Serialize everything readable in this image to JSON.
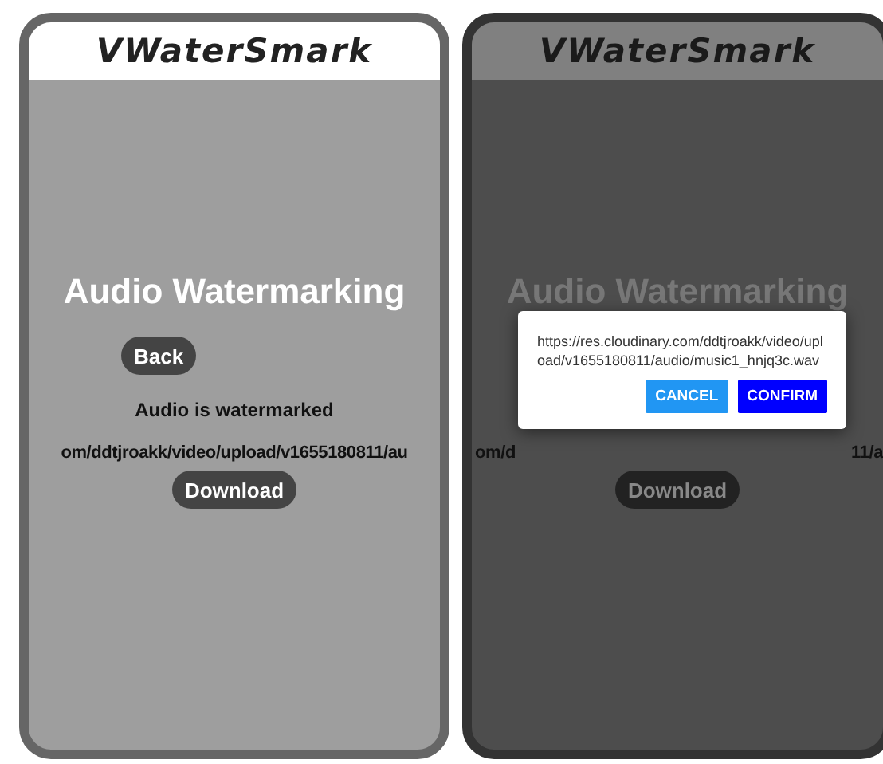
{
  "screens": [
    {
      "dimmed": false,
      "logo": "VWaterSmark",
      "title": "Audio Watermarking",
      "back_button": "Back",
      "status": "Audio is watermarked",
      "url": "om/ddtjroakk/video/upload/v1655180811/au",
      "download_button": "Download"
    },
    {
      "dimmed": true,
      "logo": "VWaterSmark",
      "title": "Audio Watermarking",
      "url_start": "om/d",
      "url_end": "11/a",
      "download_button": "Download",
      "dialog": {
        "message": "https://res.cloudinary.com/ddtjroakk/video/upload/v1655180811/audio/music1_hnjq3c.wav",
        "buttons": [
          {
            "label": "CANCEL",
            "kind": "secondary"
          },
          {
            "label": "CONFIRM",
            "kind": "primary"
          }
        ]
      }
    }
  ]
}
